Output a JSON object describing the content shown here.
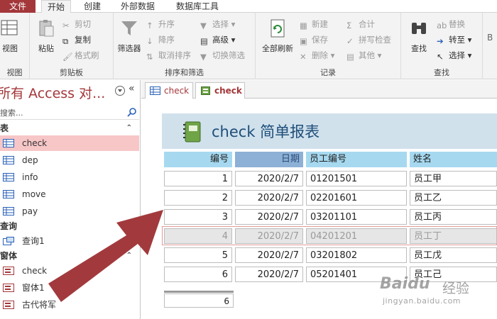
{
  "ribbon_tabs": [
    "文件",
    "开始",
    "创建",
    "外部数据",
    "数据库工具"
  ],
  "ribbon": {
    "view": {
      "label": "视图",
      "group": "视图"
    },
    "clipboard": {
      "paste": "粘贴",
      "cut": "剪切",
      "copy": "复制",
      "format_painter": "格式刷",
      "group": "剪贴板"
    },
    "sort_filter": {
      "filter": "筛选器",
      "ascending": "升序",
      "descending": "降序",
      "remove_sort": "取消排序",
      "selection": "选择",
      "advanced": "高级",
      "toggle_filter": "切换筛选",
      "group": "排序和筛选"
    },
    "records": {
      "refresh_all": "全部刷新",
      "new": "新建",
      "save": "保存",
      "delete": "删除",
      "totals": "合计",
      "spelling": "拼写检查",
      "more": "其他",
      "group": "记录"
    },
    "find": {
      "find": "查找",
      "replace": "替换",
      "goto": "转至",
      "select": "选择",
      "group": "查找"
    }
  },
  "nav": {
    "title": "所有 Access 对...",
    "search_placeholder": "搜索...",
    "sections": [
      {
        "label": "表",
        "items": [
          "check",
          "dep",
          "info",
          "move",
          "pay"
        ]
      },
      {
        "label": "查询",
        "items": [
          "查询1"
        ]
      },
      {
        "label": "窗体",
        "items": [
          "check",
          "窗体1",
          "古代将军"
        ]
      }
    ]
  },
  "doc_tabs": [
    {
      "label": "check",
      "active": false
    },
    {
      "label": "check",
      "active": true
    }
  ],
  "report": {
    "title": "check  简单报表",
    "columns": [
      "编号",
      "日期",
      "员工编号",
      "姓名"
    ],
    "rows": [
      [
        "1",
        "2020/2/7",
        "01201501",
        "员工甲"
      ],
      [
        "2",
        "2020/2/7",
        "02201601",
        "员工乙"
      ],
      [
        "3",
        "2020/2/7",
        "03201101",
        "员工丙"
      ],
      [
        "4",
        "2020/2/7",
        "04201201",
        "员工丁"
      ],
      [
        "5",
        "2020/2/7",
        "03201802",
        "员工戊"
      ],
      [
        "6",
        "2020/2/7",
        "05201401",
        "员工己"
      ]
    ],
    "selected_row": 3,
    "footer_count": "6"
  },
  "watermark": {
    "brand": "Baidu",
    "cn": "经验",
    "url": "jingyan.baidu.com"
  },
  "colors": {
    "access_red": "#a4373a",
    "header_bg": "#d0e1ec",
    "col_bg": "#a6d9f0",
    "selected_nav": "#f7c6c7",
    "arrow": "#a23a3d"
  }
}
